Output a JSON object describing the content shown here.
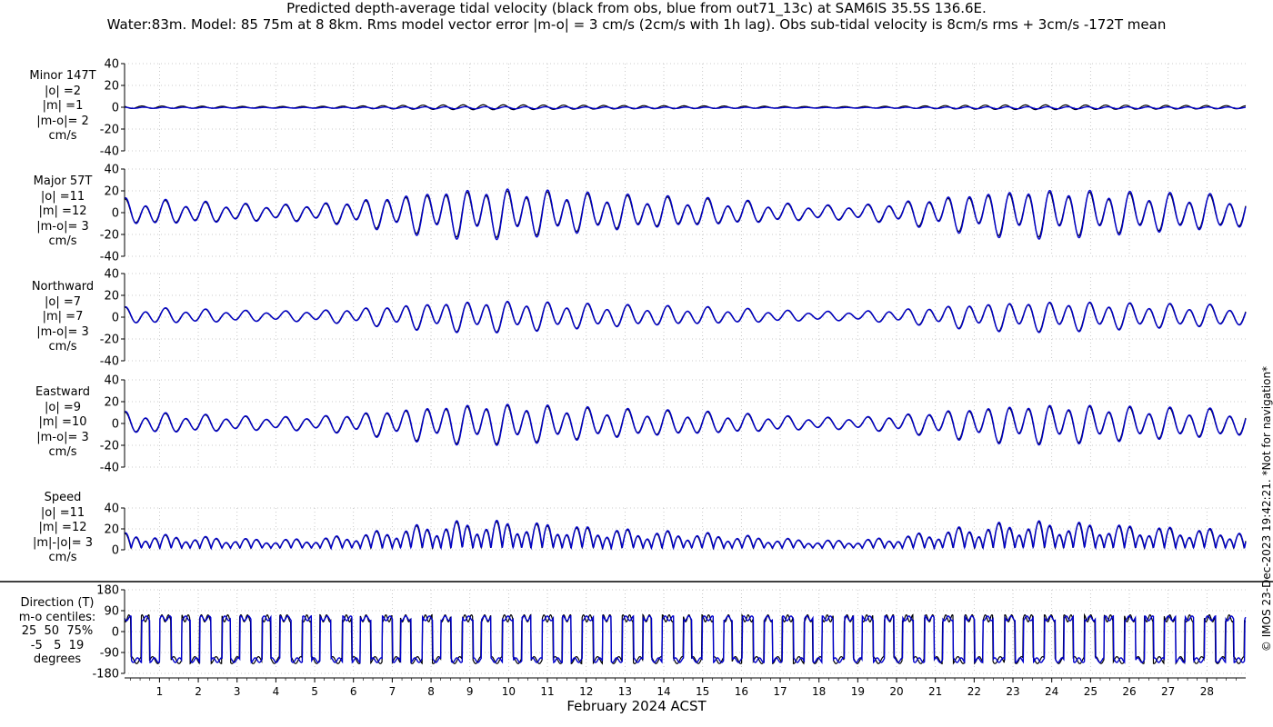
{
  "title_lines": [
    "Predicted depth-average tidal velocity (black from obs, blue from out71_13c) at SAM6IS 35.5S 136.6E.",
    "Water:83m. Model: 85 75m at 8 8km. Rms model vector error |m-o| = 3 cm/s (2cm/s with 1h lag). Obs sub-tidal velocity is 8cm/s rms + 3cm/s -172T mean"
  ],
  "xlabel": "February 2024 ACST",
  "copyright": "© IMOS 23-Dec-2023 19:42:21. *Not for navigation*",
  "colors": {
    "obs": "#000000",
    "model": "#0000cc"
  },
  "chart_data": {
    "type": "line",
    "x_tick_labels": [
      "1",
      "2",
      "3",
      "4",
      "5",
      "6",
      "7",
      "8",
      "9",
      "10",
      "11",
      "12",
      "13",
      "14",
      "15",
      "16",
      "17",
      "18",
      "19",
      "20",
      "21",
      "22",
      "23",
      "24",
      "25",
      "26",
      "27",
      "28"
    ],
    "xlim_days": [
      0.1,
      29.0
    ],
    "series_legend": [
      "obs (black)",
      "model out71_13c (blue)"
    ],
    "panels": [
      {
        "id": "minor",
        "ylabel": "Minor 147T\n|o| =2\n|m| =1\n|m-o|= 2\ncm/s",
        "ylim": [
          -40,
          40
        ],
        "ticks": [
          -40,
          -20,
          0,
          20,
          40
        ],
        "obs_amplitude": 2,
        "model_amplitude": 1
      },
      {
        "id": "major",
        "ylabel": "Major 57T\n|o| =11\n|m| =12\n|m-o|= 3\ncm/s",
        "ylim": [
          -40,
          40
        ],
        "ticks": [
          -40,
          -20,
          0,
          20,
          40
        ],
        "obs_amplitude": 11,
        "model_amplitude": 12
      },
      {
        "id": "northward",
        "ylabel": "Northward\n|o| =7\n|m| =7\n|m-o|= 3\ncm/s",
        "ylim": [
          -40,
          40
        ],
        "ticks": [
          -40,
          -20,
          0,
          20,
          40
        ],
        "obs_amplitude": 7,
        "model_amplitude": 7
      },
      {
        "id": "eastward",
        "ylabel": "Eastward\n|o| =9\n|m| =10\n|m-o|= 3\ncm/s",
        "ylim": [
          -40,
          40
        ],
        "ticks": [
          -40,
          -20,
          0,
          20,
          40
        ],
        "obs_amplitude": 9,
        "model_amplitude": 10
      },
      {
        "id": "speed",
        "ylabel": "Speed\n|o| =11\n|m| =12\n|m|-|o|= 3\ncm/s",
        "ylim": [
          0,
          40
        ],
        "ticks": [
          0,
          20,
          40
        ],
        "obs_amplitude": 11,
        "model_amplitude": 12
      },
      {
        "id": "direction",
        "ylabel": "Direction (T)\nm-o centiles:\n25  50  75%\n-5   5  19\ndegrees",
        "ylim": [
          -180,
          180
        ],
        "ticks": [
          -180,
          -90,
          0,
          90,
          180
        ],
        "centiles_25_50_75": [
          -5,
          5,
          19
        ]
      }
    ]
  }
}
